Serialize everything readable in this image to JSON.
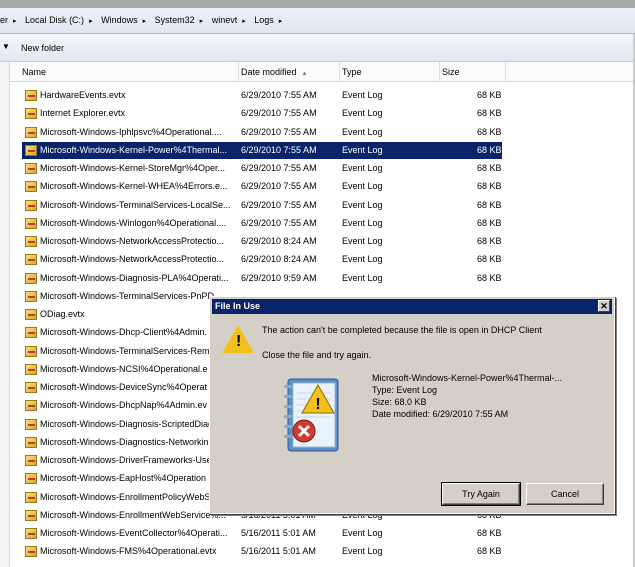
{
  "breadcrumb": [
    "er",
    "Local Disk (C:)",
    "Windows",
    "System32",
    "winevt",
    "Logs"
  ],
  "toolbar": {
    "new_folder": "New folder"
  },
  "columns": {
    "name": "Name",
    "date": "Date modified",
    "type": "Type",
    "size": "Size"
  },
  "files": [
    {
      "name": "HardwareEvents.evtx",
      "date": "6/29/2010 7:55 AM",
      "type": "Event Log",
      "size": "68 KB"
    },
    {
      "name": "Internet Explorer.evtx",
      "date": "6/29/2010 7:55 AM",
      "type": "Event Log",
      "size": "68 KB"
    },
    {
      "name": "Microsoft-Windows-Iphlpsvc%4Operational....",
      "date": "6/29/2010 7:55 AM",
      "type": "Event Log",
      "size": "68 KB"
    },
    {
      "name": "Microsoft-Windows-Kernel-Power%4Thermal...",
      "date": "6/29/2010 7:55 AM",
      "type": "Event Log",
      "size": "68 KB",
      "selected": true
    },
    {
      "name": "Microsoft-Windows-Kernel-StoreMgr%4Oper...",
      "date": "6/29/2010 7:55 AM",
      "type": "Event Log",
      "size": "68 KB"
    },
    {
      "name": "Microsoft-Windows-Kernel-WHEA%4Errors.e...",
      "date": "6/29/2010 7:55 AM",
      "type": "Event Log",
      "size": "68 KB"
    },
    {
      "name": "Microsoft-Windows-TerminalServices-LocalSe...",
      "date": "6/29/2010 7:55 AM",
      "type": "Event Log",
      "size": "68 KB"
    },
    {
      "name": "Microsoft-Windows-Winlogon%4Operational....",
      "date": "6/29/2010 7:55 AM",
      "type": "Event Log",
      "size": "68 KB"
    },
    {
      "name": "Microsoft-Windows-NetworkAccessProtectio...",
      "date": "6/29/2010 8:24 AM",
      "type": "Event Log",
      "size": "68 KB"
    },
    {
      "name": "Microsoft-Windows-NetworkAccessProtectio...",
      "date": "6/29/2010 8:24 AM",
      "type": "Event Log",
      "size": "68 KB"
    },
    {
      "name": "Microsoft-Windows-Diagnosis-PLA%4Operati...",
      "date": "6/29/2010 9:59 AM",
      "type": "Event Log",
      "size": "68 KB"
    },
    {
      "name": "Microsoft-Windows-TerminalServices-PnPD",
      "date": "",
      "type": "",
      "size": ""
    },
    {
      "name": "ODiag.evtx",
      "date": "",
      "type": "",
      "size": ""
    },
    {
      "name": "Microsoft-Windows-Dhcp-Client%4Admin.",
      "date": "",
      "type": "",
      "size": ""
    },
    {
      "name": "Microsoft-Windows-TerminalServices-Rem",
      "date": "",
      "type": "",
      "size": ""
    },
    {
      "name": "Microsoft-Windows-NCSI%4Operational.e",
      "date": "",
      "type": "",
      "size": ""
    },
    {
      "name": "Microsoft-Windows-DeviceSync%4Operat",
      "date": "",
      "type": "",
      "size": ""
    },
    {
      "name": "Microsoft-Windows-DhcpNap%4Admin.ev",
      "date": "",
      "type": "",
      "size": ""
    },
    {
      "name": "Microsoft-Windows-Diagnosis-ScriptedDiag",
      "date": "",
      "type": "",
      "size": ""
    },
    {
      "name": "Microsoft-Windows-Diagnostics-Networkin",
      "date": "",
      "type": "",
      "size": ""
    },
    {
      "name": "Microsoft-Windows-DriverFrameworks-Use",
      "date": "",
      "type": "",
      "size": ""
    },
    {
      "name": "Microsoft-Windows-EapHost%4Operation",
      "date": "",
      "type": "",
      "size": ""
    },
    {
      "name": "Microsoft-Windows-EnrollmentPolicyWebS",
      "date": "",
      "type": "",
      "size": ""
    },
    {
      "name": "Microsoft-Windows-EnrollmentWebService%...",
      "date": "5/16/2011 5:01 AM",
      "type": "Event Log",
      "size": "68 KB"
    },
    {
      "name": "Microsoft-Windows-EventCollector%4Operati...",
      "date": "5/16/2011 5:01 AM",
      "type": "Event Log",
      "size": "68 KB"
    },
    {
      "name": "Microsoft-Windows-FMS%4Operational.evtx",
      "date": "5/16/2011 5:01 AM",
      "type": "Event Log",
      "size": "68 KB"
    }
  ],
  "dialog": {
    "title": "File In Use",
    "close": "✕",
    "message": "The action can't be completed because the file is open in DHCP Client",
    "instruction": "Close the file and try again.",
    "file_name": "Microsoft-Windows-Kernel-Power%4Thermal-...",
    "file_type": "Type: Event Log",
    "file_size": "Size: 68.0 KB",
    "file_date": "Date modified: 6/29/2010 7:55 AM",
    "try_again": "Try Again",
    "cancel": "Cancel"
  }
}
